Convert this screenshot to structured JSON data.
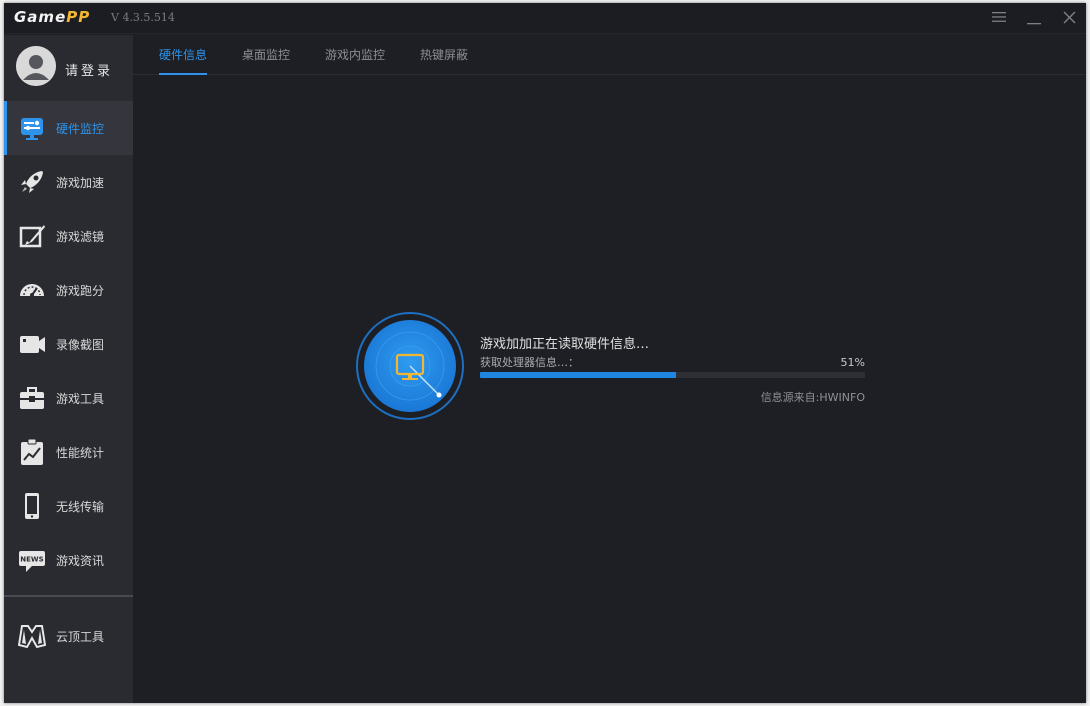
{
  "app": {
    "logo_game": "Game",
    "logo_pp": "PP",
    "version": "V 4.3.5.514"
  },
  "colors": {
    "accent": "#2e93ea",
    "sidebar_bg": "#2a2b31",
    "main_bg": "#1e1f24",
    "logo_accent": "#f2b632"
  },
  "user": {
    "login_label": "请登录"
  },
  "sidebar": {
    "items": [
      {
        "label": "硬件监控",
        "icon": "hardware-monitor-icon",
        "active": true
      },
      {
        "label": "游戏加速",
        "icon": "rocket-icon",
        "active": false
      },
      {
        "label": "游戏滤镜",
        "icon": "filter-brush-icon",
        "active": false
      },
      {
        "label": "游戏跑分",
        "icon": "speedometer-icon",
        "active": false
      },
      {
        "label": "录像截图",
        "icon": "video-camera-icon",
        "active": false
      },
      {
        "label": "游戏工具",
        "icon": "toolbox-icon",
        "active": false
      },
      {
        "label": "性能统计",
        "icon": "clipboard-chart-icon",
        "active": false
      },
      {
        "label": "无线传输",
        "icon": "phone-icon",
        "active": false
      },
      {
        "label": "游戏资讯",
        "icon": "news-icon",
        "active": false
      }
    ],
    "bottom_item": {
      "label": "云顶工具",
      "icon": "mask-icon"
    }
  },
  "tabs": [
    {
      "label": "硬件信息",
      "active": true
    },
    {
      "label": "桌面监控",
      "active": false
    },
    {
      "label": "游戏内监控",
      "active": false
    },
    {
      "label": "热键屏蔽",
      "active": false
    }
  ],
  "status": {
    "title": "游戏加加正在读取硬件信息…",
    "subtitle": "获取处理器信息…：",
    "percent_label": "51%",
    "progress": 0.51,
    "source": "信息源来自:HWINFO"
  }
}
